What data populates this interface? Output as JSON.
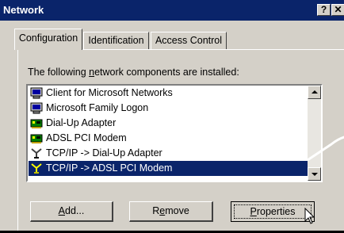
{
  "window": {
    "title": "Network",
    "help_glyph": "?",
    "close_glyph": "✕"
  },
  "tabs": [
    {
      "label": "Configuration",
      "active": true
    },
    {
      "label": "Identification",
      "active": false
    },
    {
      "label": "Access Control",
      "active": false
    }
  ],
  "components": {
    "label_prefix": "The following ",
    "label_mnemonic": "n",
    "label_suffix": "etwork components are installed:",
    "items": [
      {
        "label": "Client for Microsoft Networks",
        "icon": "client-icon",
        "selected": false
      },
      {
        "label": "Microsoft Family Logon",
        "icon": "client-icon",
        "selected": false
      },
      {
        "label": "Dial-Up Adapter",
        "icon": "adapter-icon",
        "selected": false
      },
      {
        "label": "ADSL PCI Modem",
        "icon": "adapter-icon",
        "selected": false
      },
      {
        "label": "TCP/IP -> Dial-Up Adapter",
        "icon": "protocol-icon",
        "selected": false
      },
      {
        "label": "TCP/IP -> ADSL PCI Modem",
        "icon": "protocol-icon",
        "selected": true
      }
    ]
  },
  "buttons": {
    "add_mnemonic": "A",
    "add_rest": "dd...",
    "remove_pre": "R",
    "remove_mnemonic": "e",
    "remove_rest": "move",
    "properties_mnemonic": "P",
    "properties_rest": "roperties"
  },
  "colors": {
    "titlebar": "#0a246a",
    "selection": "#0a246a",
    "face": "#d4d0c8"
  }
}
